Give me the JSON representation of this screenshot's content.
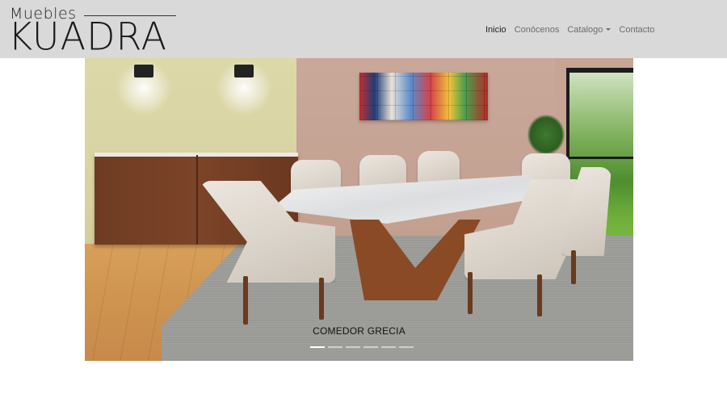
{
  "brand": {
    "top": "Muebles",
    "main": "KUADRA"
  },
  "nav": {
    "items": [
      {
        "label": "Inicio",
        "active": true
      },
      {
        "label": "Conócenos",
        "active": false
      },
      {
        "label": "Catalogo",
        "active": false,
        "dropdown": true
      },
      {
        "label": "Contacto",
        "active": false
      }
    ]
  },
  "carousel": {
    "caption": "COMEDOR GRECIA",
    "slide_count": 6,
    "active_index": 0
  },
  "colors": {
    "navbar_bg": "#d9d9d9",
    "nav_active": "#1f1f1f",
    "nav_text": "#6b6b6b"
  }
}
